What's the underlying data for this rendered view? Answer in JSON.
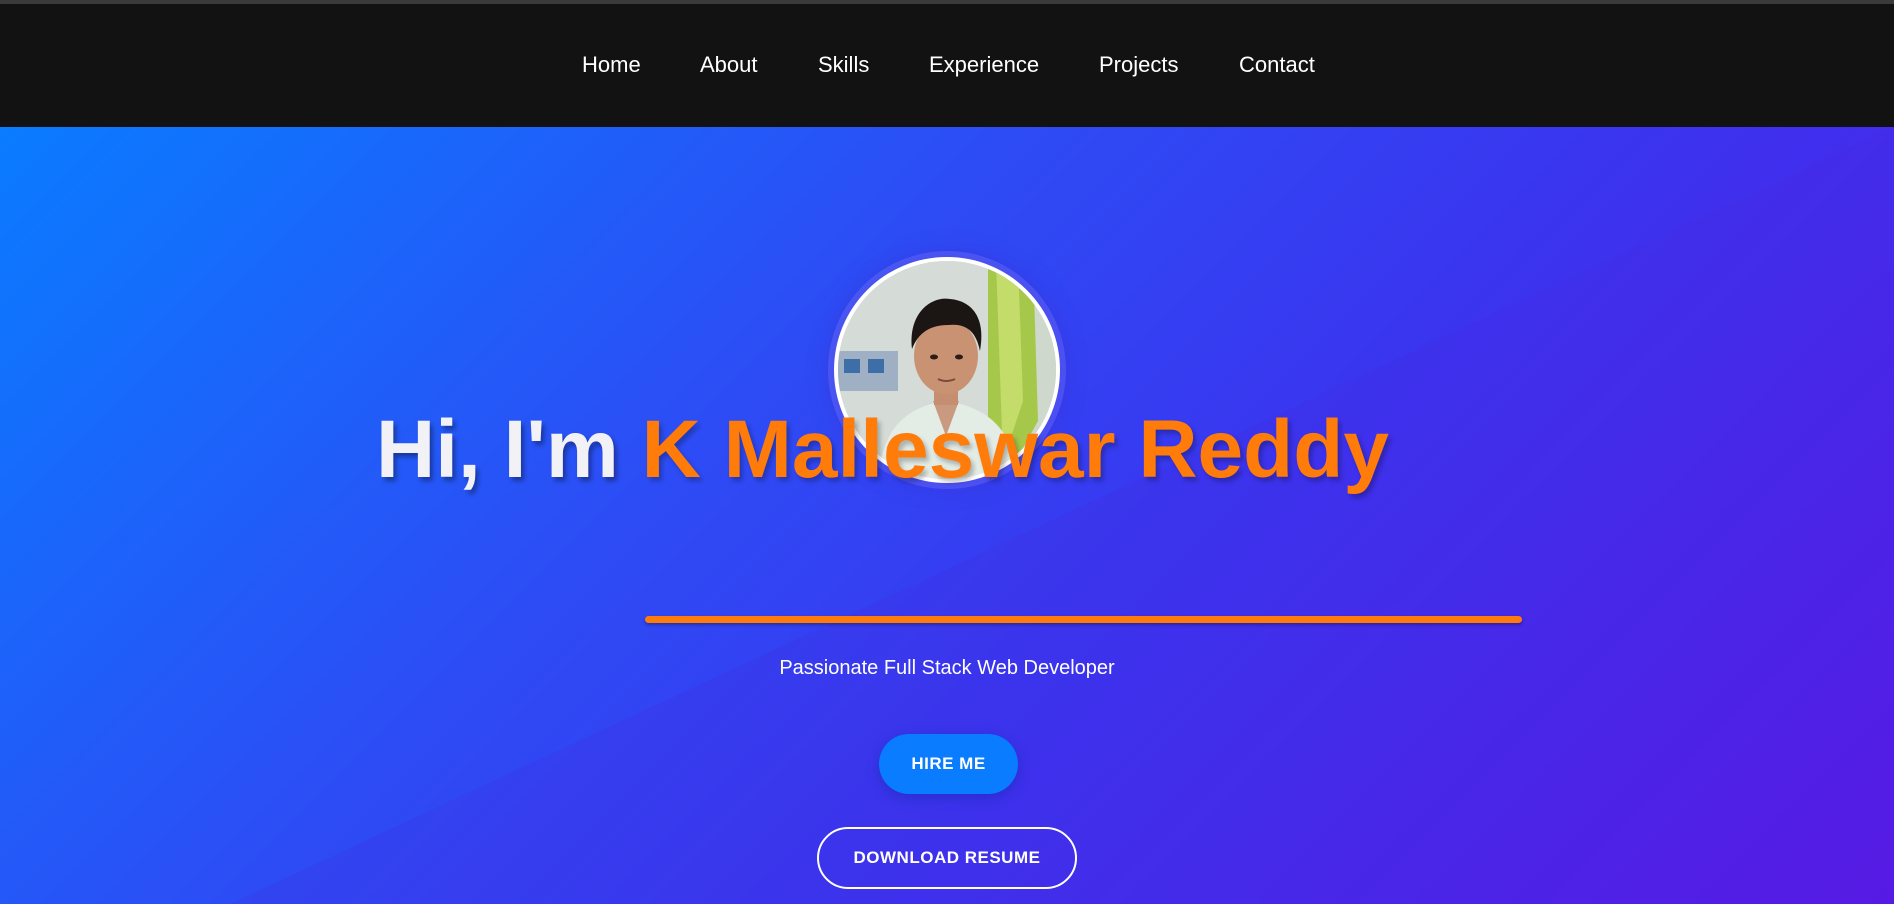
{
  "nav": {
    "items": [
      {
        "label": "Home"
      },
      {
        "label": "About"
      },
      {
        "label": "Skills"
      },
      {
        "label": "Experience"
      },
      {
        "label": "Projects"
      },
      {
        "label": "Contact"
      }
    ]
  },
  "hero": {
    "greeting": "Hi, I'm",
    "name": "K Malleswar Reddy",
    "tagline": "Passionate Full Stack Web Developer",
    "hire_label": "HIRE ME",
    "resume_label": "DOWNLOAD RESUME"
  },
  "colors": {
    "navbar_bg": "#121212",
    "accent_orange": "#ff7b0a",
    "button_blue": "#0a7cff",
    "gradient_start": "#0a7cff",
    "gradient_end": "#5a18e6"
  },
  "icons": {
    "profile_photo": "profile-photo"
  }
}
